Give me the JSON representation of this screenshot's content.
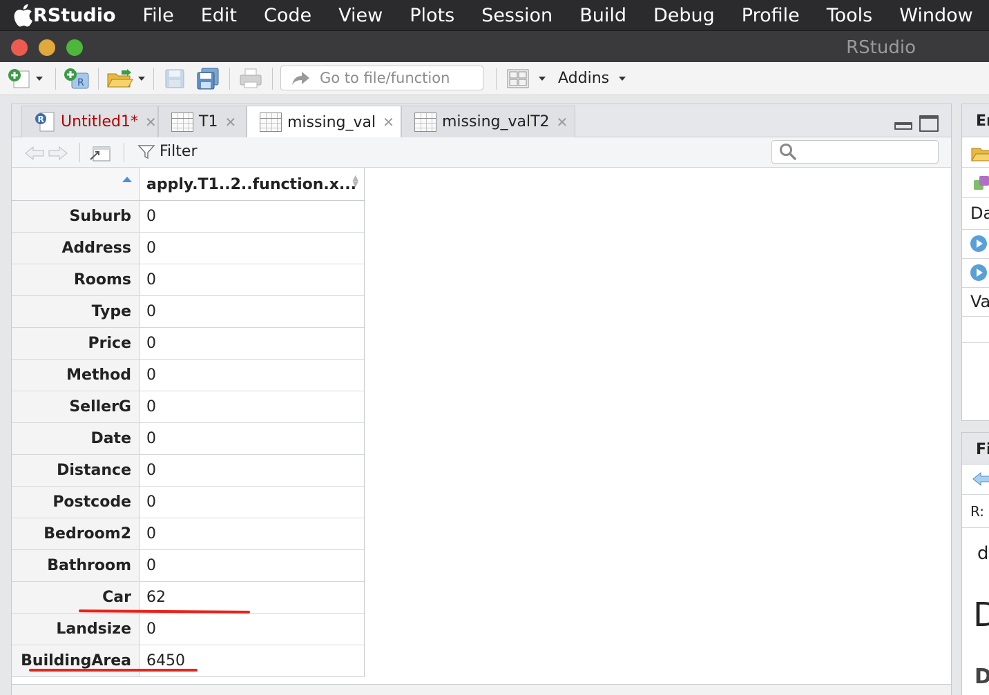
{
  "menubar": {
    "app": "RStudio",
    "items": [
      "File",
      "Edit",
      "Code",
      "View",
      "Plots",
      "Session",
      "Build",
      "Debug",
      "Profile",
      "Tools",
      "Window"
    ]
  },
  "window": {
    "title": "RStudio"
  },
  "toolbar": {
    "goto_placeholder": "Go to file/function",
    "addins_label": "Addins"
  },
  "tabs": [
    {
      "label": "Untitled1*",
      "type": "r-script",
      "active": false
    },
    {
      "label": "T1",
      "type": "data",
      "active": false
    },
    {
      "label": "missing_val",
      "type": "data",
      "active": true
    },
    {
      "label": "missing_valT2",
      "type": "data",
      "active": false
    }
  ],
  "viewer": {
    "filter_label": "Filter",
    "column_header": "apply.T1..2..function.x...",
    "rows": [
      {
        "name": "Suburb",
        "value": "0"
      },
      {
        "name": "Address",
        "value": "0"
      },
      {
        "name": "Rooms",
        "value": "0"
      },
      {
        "name": "Type",
        "value": "0"
      },
      {
        "name": "Price",
        "value": "0"
      },
      {
        "name": "Method",
        "value": "0"
      },
      {
        "name": "SellerG",
        "value": "0"
      },
      {
        "name": "Date",
        "value": "0"
      },
      {
        "name": "Distance",
        "value": "0"
      },
      {
        "name": "Postcode",
        "value": "0"
      },
      {
        "name": "Bedroom2",
        "value": "0"
      },
      {
        "name": "Bathroom",
        "value": "0"
      },
      {
        "name": "Car",
        "value": "62"
      },
      {
        "name": "Landsize",
        "value": "0"
      },
      {
        "name": "BuildingArea",
        "value": "6450"
      }
    ]
  },
  "right_panes": {
    "top_tab": "En",
    "row_da": "Da",
    "row_va": "Va",
    "bottom_tab": "Fi",
    "path": "R:",
    "text_d_small": "d",
    "text_d_large": "D",
    "text_d_bold": "D"
  },
  "colors": {
    "annotation": "#e8231b",
    "dirty_tab": "#b20000",
    "sort_indicator": "#4a90d9"
  }
}
